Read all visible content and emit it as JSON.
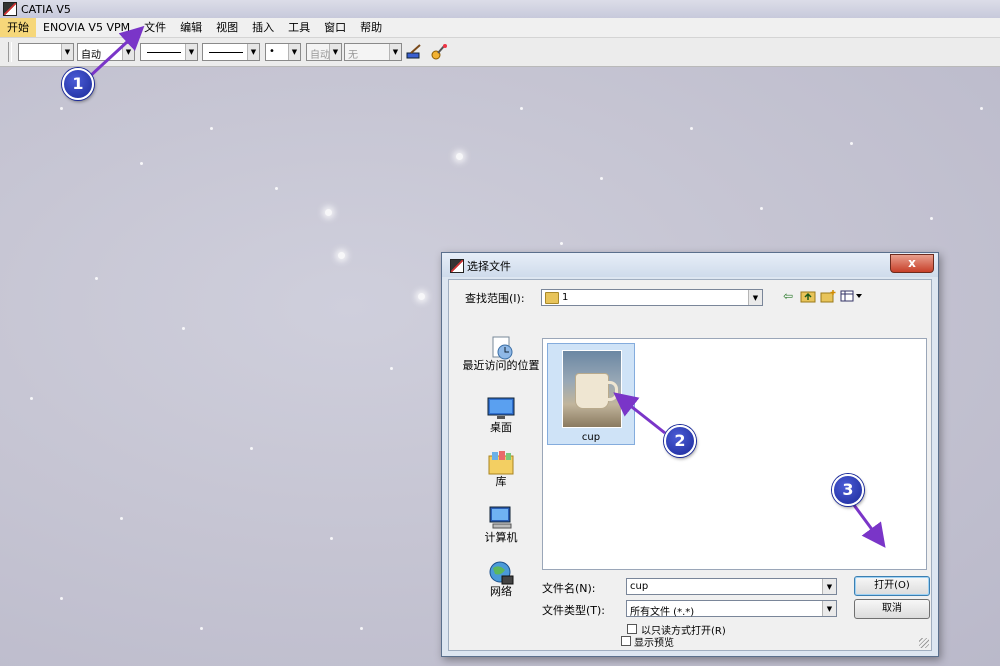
{
  "window": {
    "title": "CATIA V5"
  },
  "menu": {
    "items": [
      "开始",
      "ENOVIA V5 VPM",
      "文件",
      "编辑",
      "视图",
      "插入",
      "工具",
      "窗口",
      "帮助"
    ]
  },
  "toolbar": {
    "combo_color": "",
    "combo_weight": "自动",
    "combo_autofill": "自动",
    "combo_none": "无",
    "point_symbol": "•",
    "icons": [
      "painter-icon",
      "format-brush-icon"
    ]
  },
  "annotations": {
    "step1": "1",
    "step2": "2",
    "step3": "3",
    "color": "#7a35c8"
  },
  "dialog": {
    "title": "选择文件",
    "close_label": "x",
    "lookin_label": "查找范围(I):",
    "lookin_value": "1",
    "places": [
      "最近访问的位置",
      "桌面",
      "库",
      "计算机",
      "网络"
    ],
    "files": [
      {
        "name": "cup",
        "icon": "image-thumbnail"
      }
    ],
    "filename_label": "文件名(N):",
    "filename_value": "cup",
    "filetype_label": "文件类型(T):",
    "filetype_value": "所有文件 (*.*)",
    "open_button": "打开(O)",
    "cancel_button": "取消",
    "readonly_label": "以只读方式打开(R)",
    "preview_label": "显示预览"
  }
}
